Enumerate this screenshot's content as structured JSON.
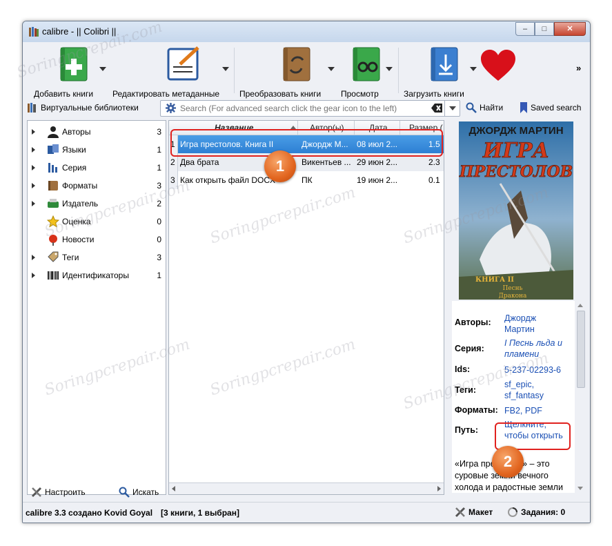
{
  "window": {
    "title": "calibre - || Colibri ||",
    "minimize": "–",
    "maximize": "□",
    "close": "✕"
  },
  "toolbar": {
    "add": "Добавить книги",
    "edit": "Редактировать метаданные",
    "convert": "Преобразовать книги",
    "view": "Просмотр",
    "download": "Загрузить книги",
    "more": "»"
  },
  "searchbar": {
    "virtual_libraries": "Виртуальные библиотеки",
    "placeholder": "Search (For advanced search click the gear icon to the left)",
    "find": "Найти",
    "saved": "Saved search"
  },
  "tags": [
    {
      "label": "Авторы",
      "count": "3",
      "icon": "person-icon",
      "expand": true
    },
    {
      "label": "Языки",
      "count": "1",
      "icon": "language-icon",
      "expand": true
    },
    {
      "label": "Серия",
      "count": "1",
      "icon": "series-icon",
      "expand": true
    },
    {
      "label": "Форматы",
      "count": "3",
      "icon": "format-icon",
      "expand": true
    },
    {
      "label": "Издатель",
      "count": "2",
      "icon": "publisher-icon",
      "expand": true
    },
    {
      "label": "Оценка",
      "count": "0",
      "icon": "star-icon",
      "expand": false
    },
    {
      "label": "Новости",
      "count": "0",
      "icon": "news-icon",
      "expand": false
    },
    {
      "label": "Теги",
      "count": "3",
      "icon": "tag-icon",
      "expand": true
    },
    {
      "label": "Идентификаторы",
      "count": "1",
      "icon": "barcode-icon",
      "expand": true
    }
  ],
  "left_bottom": {
    "configure": "Настроить",
    "find": "Искать"
  },
  "books": {
    "columns": [
      "Название",
      "Автор(ы)",
      "Дата",
      "Размер ("
    ],
    "rows": [
      {
        "n": "1",
        "title": "Игра престолов. Книга II",
        "author": "Джордж М...",
        "date": "08 июл 2...",
        "size": "1.5"
      },
      {
        "n": "2",
        "title": "Два брата",
        "author": "Викентьев ...",
        "date": "29 июн 2...",
        "size": "2.3"
      },
      {
        "n": "3",
        "title": "Как открыть файл DOCX",
        "author": "ПК",
        "date": "19 июн 2...",
        "size": "0.1"
      }
    ]
  },
  "cover": {
    "author": "ДЖОРДЖ МАРТИН",
    "title1": "ИГРА",
    "title2": "ПРЕСТОЛОВ",
    "book": "КНИГА II",
    "series1": "Песнь",
    "series2": "Дракона"
  },
  "details": {
    "authors_label": "Авторы:",
    "authors_value1": "Джордж",
    "authors_value2": "Мартин",
    "series_label": "Серия:",
    "series_value1": "I Песнь льда и",
    "series_value2": "пламени",
    "ids_label": "Ids:",
    "ids_value": "5-237-02293-6",
    "tags_label": "Теги:",
    "tags_value1": "sf_epic,",
    "tags_value2": "sf_fantasy",
    "formats_label": "Форматы:",
    "formats_value": "FB2, PDF",
    "path_label": "Путь:",
    "path_value1": "Щелкните,",
    "path_value2": "чтобы открыть",
    "description": "«Игра престолов» – это суровые земли вечного холода и радостные земли вечного лета. Это легенда о"
  },
  "statusbar": {
    "left": "calibre 3.3 создано Kovid Goyal",
    "count": "[3 книги, 1 выбран]",
    "layout": "Макет",
    "jobs": "Задания: 0"
  },
  "callouts": {
    "one": "1",
    "two": "2"
  },
  "watermark": "Soringpcrepair.com",
  "colors": {
    "selection": "#2d7fd3",
    "callout": "#e0211e",
    "badge": "#e2651f",
    "link": "#1a4fb4"
  }
}
